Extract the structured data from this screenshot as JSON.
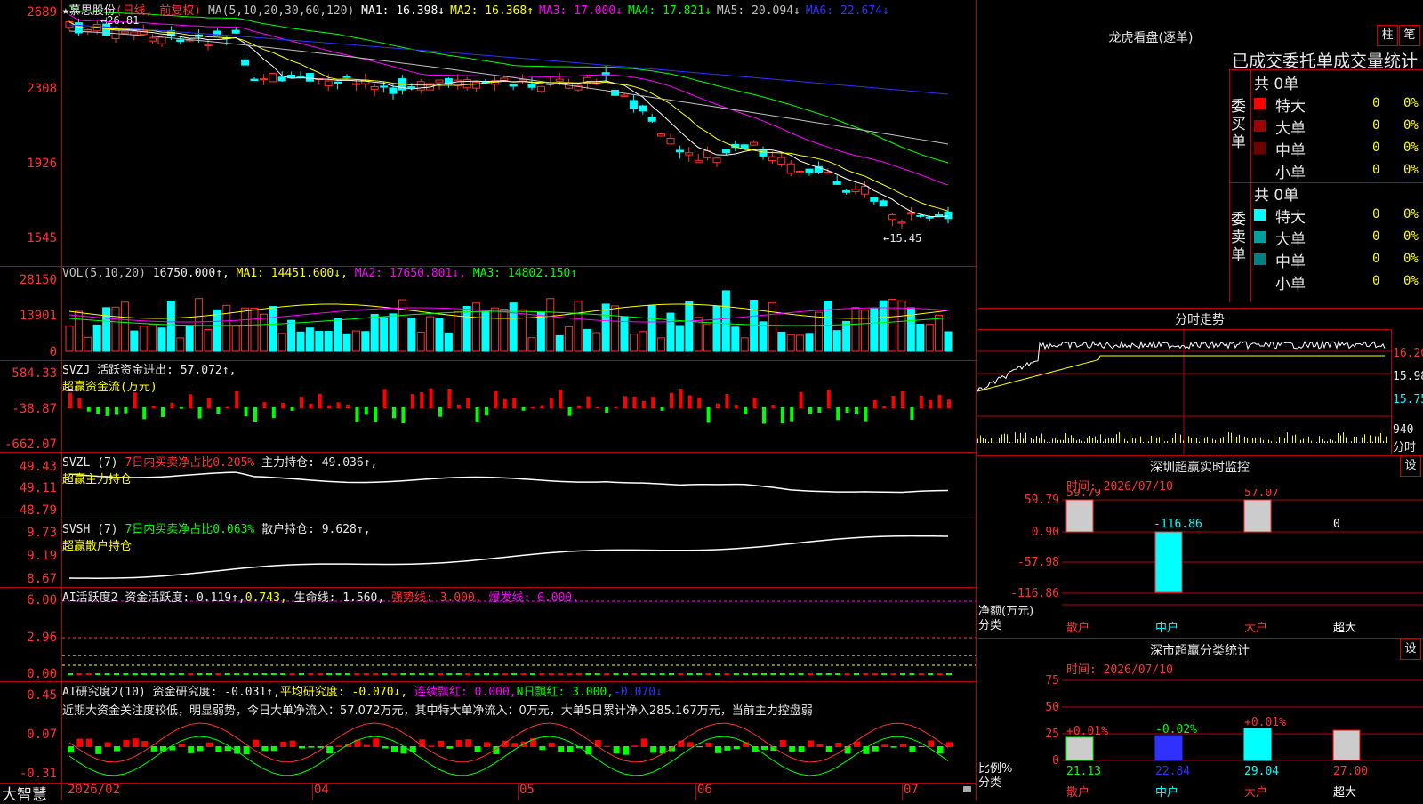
{
  "stock": {
    "name": "★慕思股份",
    "mode": "(日线, 前复权)",
    "ma_label": "MA(5,10,20,30,60,120)",
    "ma": [
      {
        "label": "MA1:",
        "value": "16.398↓",
        "color": "#ffffff"
      },
      {
        "label": "MA2:",
        "value": "16.368↑",
        "color": "#ffff00"
      },
      {
        "label": "MA3:",
        "value": "17.000↓",
        "color": "#ff00ff"
      },
      {
        "label": "MA4:",
        "value": "17.821↓",
        "color": "#00ff00"
      },
      {
        "label": "MA5:",
        "value": "20.094↓",
        "color": "#c0c0c0"
      },
      {
        "label": "MA6:",
        "value": "22.674↓",
        "color": "#3030ff"
      }
    ],
    "high_mark": "26.81",
    "low_mark": "15.45",
    "price_axis": [
      "2689",
      "2308",
      "1926",
      "1545"
    ]
  },
  "vol": {
    "label": "VOL(5,10,20)",
    "value": "16750.000↑,",
    "ma1": "MA1: 14451.600↓,",
    "ma2": "MA2: 17650.801↓,",
    "ma3": "MA3: 14802.150↑",
    "axis": [
      "28150",
      "13901",
      "0"
    ]
  },
  "svzj": {
    "label": "SVZJ  活跃资金进出: 57.072↑,",
    "sub": "超赢资金流(万元)",
    "axis": [
      "584.33",
      "-38.87",
      "-662.07"
    ]
  },
  "svzl": {
    "label": "SVZL (7)",
    "ratio": "7日内买卖净占比0.205%",
    "hold": "主力持仓: 49.036↑,",
    "sub": "超赢主力持仓",
    "axis": [
      "49.43",
      "49.11",
      "48.79"
    ]
  },
  "svsh": {
    "label": "SVSH (7)",
    "ratio": "7日内买卖净占比0.063%",
    "hold": "散户持仓: 9.628↑,",
    "sub": "超赢散户持仓",
    "axis": [
      "9.73",
      "9.19",
      "8.67"
    ]
  },
  "ai_active": {
    "label": "AI活跃度2",
    "a": "资金活跃度: 0.119↑,",
    "b": "0.743,",
    "c": "生命线: 1.560,",
    "d": "强势线: 3.000,",
    "e": "爆发线: 6.000,",
    "axis": [
      "6.00",
      "2.96",
      "0.00"
    ]
  },
  "ai_research": {
    "label": "AI研究度2(10)",
    "a": "资金研究度: -0.031↑,",
    "b": "平均研究度: -0.070↓,",
    "c": "连续飘红: 0.000,",
    "d": "N日飘红: 3.000,",
    "e": "-0.070↓",
    "comment": "近期大资金关注度较低，明显弱势，今日大单净流入：57.072万元，其中特大单净流入：0万元，大单5日累计净入285.167万元，当前主力控盘弱",
    "axis": [
      "0.45",
      "0.07",
      "-0.31"
    ]
  },
  "bottom": {
    "brand": "大智慧",
    "year": "2026/02",
    "months": [
      "04",
      "05",
      "06",
      "07"
    ]
  },
  "dragon": {
    "title": "龙虎看盘(逐单)",
    "btn1": "柱",
    "btn2": "笔",
    "tabs": "已成交委托单成交量统计",
    "buy_label": "委买单",
    "sell_label": "委卖单",
    "buy_total": "共 0单",
    "sell_total": "共 0单",
    "buy_rows": [
      {
        "name": "特大",
        "count": "0",
        "pct": "0%",
        "color": "#ff0000"
      },
      {
        "name": "大单",
        "count": "0",
        "pct": "0%",
        "color": "#a00000"
      },
      {
        "name": "中单",
        "count": "0",
        "pct": "0%",
        "color": "#700000"
      },
      {
        "name": "小单",
        "count": "0",
        "pct": "0%",
        "color": "#000000"
      }
    ],
    "sell_rows": [
      {
        "name": "特大",
        "count": "0",
        "pct": "0%",
        "color": "#00ffff"
      },
      {
        "name": "大单",
        "count": "0",
        "pct": "0%",
        "color": "#00a0a0"
      },
      {
        "name": "中单",
        "count": "0",
        "pct": "0%",
        "color": "#008080"
      },
      {
        "name": "小单",
        "count": "0",
        "pct": "0%",
        "color": "#000000"
      }
    ]
  },
  "intraday": {
    "title": "分时走势",
    "prices": [
      "16.20",
      "15.98",
      "15.75"
    ],
    "vol": "940",
    "vol_unit": "分时"
  },
  "sz_monitor": {
    "title": "深圳超赢实时监控",
    "set": "设",
    "time": "时间: 2026/07/10",
    "axis": [
      "59.79",
      "0.90",
      "-57.98",
      "-116.86"
    ],
    "unit1": "净额(万元)",
    "unit2": "分类",
    "cats": [
      "散户",
      "中户",
      "大户",
      "超大"
    ],
    "values": [
      "59.79",
      "-116.86",
      "57.07",
      "0"
    ]
  },
  "sz_class": {
    "title": "深市超赢分类统计",
    "set": "设",
    "time": "时间: 2026/07/10",
    "axis": [
      "75",
      "50",
      "25",
      "0"
    ],
    "unit1": "比例%",
    "unit2": "分类",
    "cats": [
      "散户",
      "中户",
      "大户",
      "超大"
    ],
    "changes": [
      "+0.01%",
      "-0.02%",
      "+0.01%",
      ""
    ],
    "values": [
      "21.13",
      "22.84",
      "29.04",
      "27.00"
    ]
  }
}
